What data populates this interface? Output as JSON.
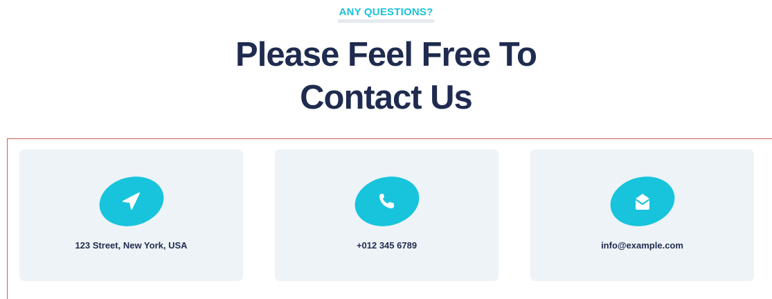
{
  "section": {
    "eyebrow": "ANY QUESTIONS?",
    "title_line1": "Please Feel Free To",
    "title_line2": "Contact Us"
  },
  "contacts": [
    {
      "icon": "location-arrow-icon",
      "text": "123 Street, New York, USA"
    },
    {
      "icon": "phone-icon",
      "text": "+012 345 6789"
    },
    {
      "icon": "envelope-open-icon",
      "text": "info@example.com"
    }
  ],
  "colors": {
    "accent": "#17c4dc",
    "heading": "#1f2b4f",
    "card_bg": "#eef3f7",
    "frame_border": "#cf5a4e"
  }
}
